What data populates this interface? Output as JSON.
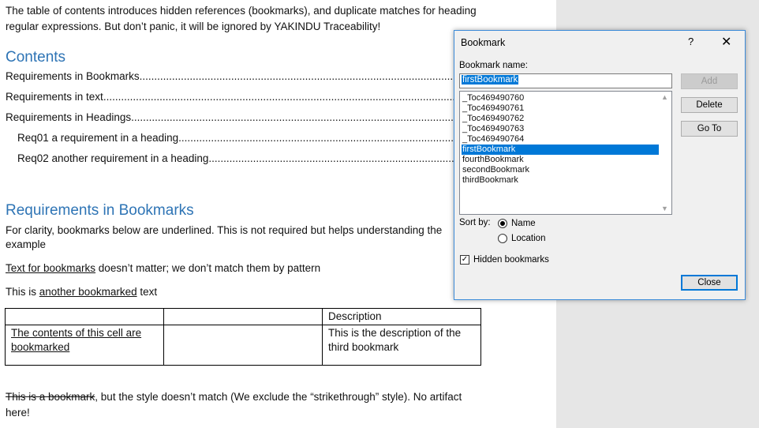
{
  "document": {
    "intro_line1": "The table of contents introduces hidden references (bookmarks), and duplicate matches for heading",
    "intro_line2": "regular expressions. But don’t panic, it will be ignored by YAKINDU Traceability!",
    "contents_heading": "Contents",
    "toc": [
      "Requirements in Bookmarks",
      "Requirements in text",
      "Requirements in Headings",
      "Req01 a requirement in a heading",
      "Req02 another requirement in a heading"
    ],
    "section_heading": "Requirements in Bookmarks",
    "para1_line1": "For clarity, bookmarks below are underlined. This is not required but helps understanding the",
    "para1_line2": "example",
    "para2_bookmark": "Text for bookmarks",
    "para2_rest": " doesn’t matter; we don’t match them by pattern",
    "para3_prefix": "This is ",
    "para3_bookmark": "another bookmarked",
    "para3_suffix": " text",
    "table": {
      "header": [
        "",
        "",
        "Description"
      ],
      "row1_col1_line1": "The contents of this cell are",
      "row1_col1_line2": "bookmarked",
      "row1_col2": "",
      "row1_col3_line1": "This is the description of the",
      "row1_col3_line2": "third bookmark"
    },
    "para4_strike": "This is a bookmark",
    "para4_rest": ", but the style doesn’t match (We exclude the “strikethrough” style). No artifact",
    "para4_line2": "here!"
  },
  "dialog": {
    "title": "Bookmark",
    "help": "?",
    "close_glyph": "✕",
    "name_label": "Bookmark name:",
    "name_value": "firstBookmark",
    "bookmarks": [
      "_Toc469490760",
      "_Toc469490761",
      "_Toc469490762",
      "_Toc469490763",
      "_Toc469490764",
      "firstBookmark",
      "fourthBookmark",
      "secondBookmark",
      "thirdBookmark"
    ],
    "selected_index": 5,
    "sort_label": "Sort by:",
    "sort_name": "Name",
    "sort_location": "Location",
    "sort_selected": "Name",
    "hidden_label": "Hidden bookmarks",
    "hidden_checked": true,
    "buttons": {
      "add": "Add",
      "delete": "Delete",
      "goto": "Go To",
      "close": "Close"
    }
  }
}
